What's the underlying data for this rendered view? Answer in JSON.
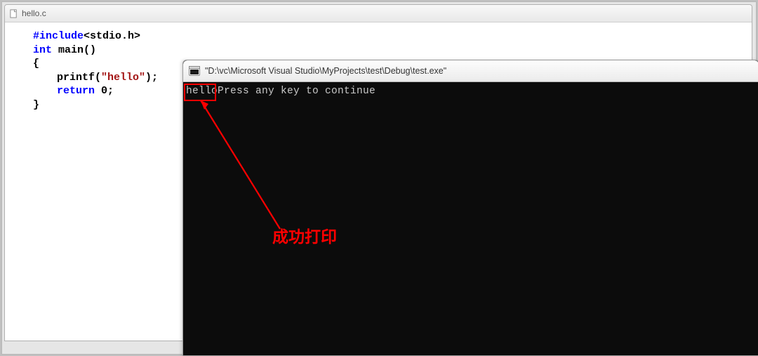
{
  "editor": {
    "filename": "hello.c",
    "code": {
      "pp_include": "#include",
      "header": "<stdio.h>",
      "kw_int": "int",
      "fn_main": "main()",
      "brace_open": "{",
      "printf_call": "printf(",
      "printf_arg": "\"hello\"",
      "printf_end": ");",
      "kw_return": "return",
      "ret_val": "0",
      "semi": ";",
      "brace_close": "}"
    }
  },
  "console": {
    "title": "\"D:\\vc\\Microsoft Visual Studio\\MyProjects\\test\\Debug\\test.exe\"",
    "output_hello": "hello",
    "output_prompt": "Press any key to continue"
  },
  "annotation": {
    "label": "成功打印"
  }
}
